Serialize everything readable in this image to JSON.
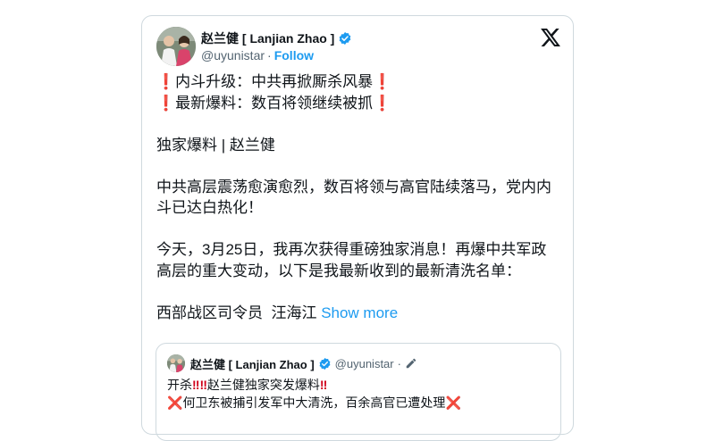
{
  "author": {
    "display_name": "赵兰健 [ Lanjian Zhao ]",
    "handle": "@uyunistar",
    "separator": "·",
    "follow_label": "Follow"
  },
  "post": {
    "line1_text": "内斗升级：中共再掀厮杀风暴",
    "line2_text": "最新爆料：数百将领继续被抓",
    "exclaim": "❗",
    "line3": "独家爆料 | 赵兰健",
    "para1": "中共高层震荡愈演愈烈，数百将领与高官陆续落马，党内内斗已达白热化！",
    "para2": "今天，3月25日，我再次获得重磅独家消息！再爆中共军政高层的重大变动，以下是我最新收到的最新清洗名单：",
    "para3": "西部战区司令员  汪海江",
    "show_more_label": "Show more"
  },
  "quote": {
    "display_name": "赵兰健 [ Lanjian Zhao ]",
    "handle": "@uyunistar",
    "separator": "·",
    "line1_prefix": "开杀",
    "line1_marks": "‼‼",
    "line1_text": "赵兰健独家突发爆料",
    "line1_end": "‼",
    "line2_x": "❌",
    "line2_text": "何卫东被捕引发军中大清洗，百余高官已遭处理"
  },
  "icons": {
    "brand": "x-logo-icon",
    "verified": "verified-badge-icon",
    "edit": "edit-pencil-icon"
  },
  "colors": {
    "link": "#1d9bf0",
    "verified": "#1d9bf0",
    "alert": "#d0021b",
    "muted": "#536471"
  }
}
